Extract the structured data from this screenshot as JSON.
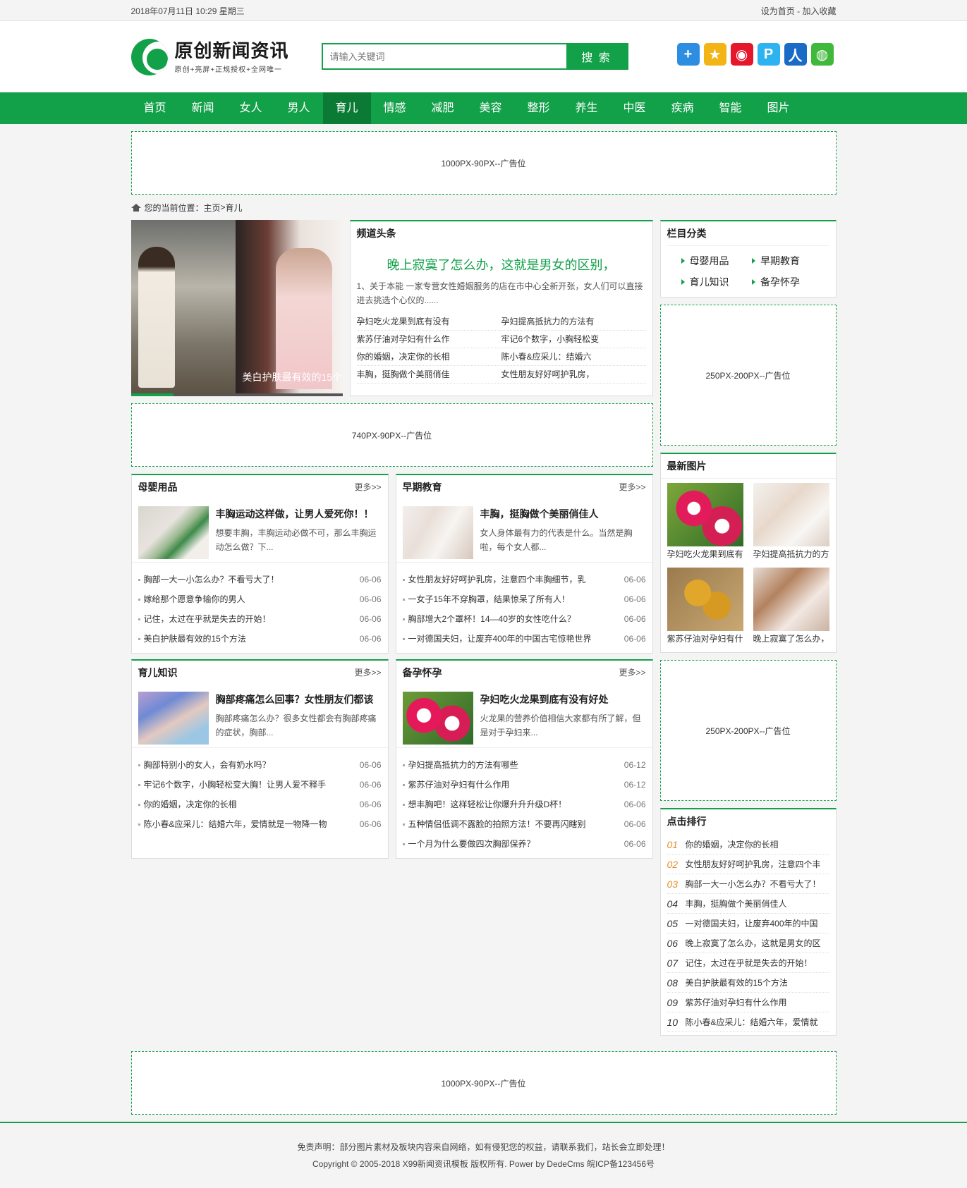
{
  "topbar": {
    "date": "2018年07月11日 10:29 星期三",
    "set_home": "设为首页",
    "sep": " - ",
    "favorite": "加入收藏"
  },
  "logo": {
    "title": "原创新闻资讯",
    "subtitle": "原创+亮屏+正规授权+全网唯一"
  },
  "search": {
    "placeholder": "请输入关键词",
    "button": "搜 索"
  },
  "share_icons": [
    {
      "name": "qzone-plus-icon",
      "color": "#2d8de0",
      "glyph": "+"
    },
    {
      "name": "qzone-star-icon",
      "color": "#f3b416",
      "glyph": "★"
    },
    {
      "name": "weibo-icon",
      "color": "#e6162d",
      "glyph": "◉"
    },
    {
      "name": "pengyou-icon",
      "color": "#2db3f0",
      "glyph": "P"
    },
    {
      "name": "renren-icon",
      "color": "#1a6bc6",
      "glyph": "人"
    },
    {
      "name": "wechat-icon",
      "color": "#3fb83b",
      "glyph": "◍"
    }
  ],
  "nav": [
    "首页",
    "新闻",
    "女人",
    "男人",
    "育儿",
    "情感",
    "减肥",
    "美容",
    "整形",
    "养生",
    "中医",
    "疾病",
    "智能",
    "图片"
  ],
  "nav_active": 4,
  "ads": {
    "top": "1000PX-90PX--广告位",
    "mid": "740PX-90PX--广告位",
    "right1": "250PX-200PX--广告位",
    "right2": "250PX-200PX--广告位",
    "bottom": "1000PX-90PX--广告位"
  },
  "breadcrumb": {
    "prefix": "您的当前位置：",
    "home": "主页",
    "sep": " > ",
    "current": "育儿"
  },
  "slider": {
    "caption": "美白护肤最有效的15个"
  },
  "headline": {
    "label": "频道头条",
    "title": "晚上寂寞了怎么办，这就是男女的区别，",
    "desc": "1、关于本能 一家专营女性婚姻服务的店在市中心全新开张，女人们可以直接进去挑选个心仪的......",
    "links": [
      "孕妇吃火龙果到底有没有",
      "孕妇提高抵抗力的方法有",
      "紫苏仔油对孕妇有什么作",
      "牢记6个数字，小胸轻松变",
      "你的婚姻，决定你的长相",
      "陈小春&应采儿：结婚六",
      "丰胸，挺胸做个美丽俏佳",
      "女性朋友好好呵护乳房，"
    ]
  },
  "categories": [
    {
      "title": "母婴用品",
      "more": "更多>>",
      "feat_title": "丰胸运动这样做，让男人爱死你！！",
      "feat_desc": "想要丰胸，丰胸运动必做不可，那么丰胸运动怎么做？下...",
      "items": [
        {
          "t": "胸部一大一小怎么办？不看亏大了！",
          "d": "06-06"
        },
        {
          "t": "嫁给那个愿意争输你的男人",
          "d": "06-06"
        },
        {
          "t": "记住，太过在乎就是失去的开始！",
          "d": "06-06"
        },
        {
          "t": "美白护肤最有效的15个方法",
          "d": "06-06"
        }
      ]
    },
    {
      "title": "早期教育",
      "more": "更多>>",
      "feat_title": "丰胸，挺胸做个美丽俏佳人",
      "feat_desc": "女人身体最有力的代表是什么。当然是胸啦，每个女人都...",
      "items": [
        {
          "t": "女性朋友好好呵护乳房，注意四个丰胸细节，乳",
          "d": "06-06"
        },
        {
          "t": "一女子15年不穿胸罩，结果惊呆了所有人！",
          "d": "06-06"
        },
        {
          "t": "胸部增大2个罩杯！14—40岁的女性吃什么？",
          "d": "06-06"
        },
        {
          "t": "一对德国夫妇，让废弃400年的中国古宅惊艳世界",
          "d": "06-06"
        }
      ]
    },
    {
      "title": "育儿知识",
      "more": "更多>>",
      "feat_title": "胸部疼痛怎么回事？女性朋友们都该",
      "feat_desc": "胸部疼痛怎么办？很多女性都会有胸部疼痛的症状，胸部...",
      "items": [
        {
          "t": "胸部特别小的女人，会有奶水吗？",
          "d": "06-06"
        },
        {
          "t": "牢记6个数字，小胸轻松变大胸！让男人爱不释手",
          "d": "06-06"
        },
        {
          "t": "你的婚姻，决定你的长相",
          "d": "06-06"
        },
        {
          "t": "陈小春&应采儿：结婚六年，爱情就是一物降一物",
          "d": "06-06"
        }
      ]
    },
    {
      "title": "备孕怀孕",
      "more": "更多>>",
      "feat_title": "孕妇吃火龙果到底有没有好处",
      "feat_desc": "火龙果的营养价值相信大家都有所了解，但是对于孕妇来...",
      "items": [
        {
          "t": "孕妇提高抵抗力的方法有哪些",
          "d": "06-12"
        },
        {
          "t": "紫苏仔油对孕妇有什么作用",
          "d": "06-12"
        },
        {
          "t": "想丰胸吧！这样轻松让你爆升升升级D杯！",
          "d": "06-06"
        },
        {
          "t": "五种情侣低调不露脸的拍照方法！不要再闪瞎别",
          "d": "06-06"
        },
        {
          "t": "一个月为什么要做四次胸部保养？",
          "d": "06-06"
        }
      ]
    }
  ],
  "sidebar": {
    "cat_title": "栏目分类",
    "cats": [
      "母婴用品",
      "早期教育",
      "育儿知识",
      "备孕怀孕"
    ],
    "pics_title": "最新图片",
    "pics": [
      "孕妇吃火龙果到底有",
      "孕妇提高抵抗力的方",
      "紫苏仔油对孕妇有什",
      "晚上寂寞了怎么办，"
    ],
    "rank_title": "点击排行",
    "rank": [
      {
        "n": "01",
        "t": "你的婚姻，决定你的长相"
      },
      {
        "n": "02",
        "t": "女性朋友好好呵护乳房，注意四个丰"
      },
      {
        "n": "03",
        "t": "胸部一大一小怎么办？不看亏大了！"
      },
      {
        "n": "04",
        "t": "丰胸，挺胸做个美丽俏佳人"
      },
      {
        "n": "05",
        "t": "一对德国夫妇，让废弃400年的中国"
      },
      {
        "n": "06",
        "t": "晚上寂寞了怎么办，这就是男女的区"
      },
      {
        "n": "07",
        "t": "记住，太过在乎就是失去的开始！"
      },
      {
        "n": "08",
        "t": "美白护肤最有效的15个方法"
      },
      {
        "n": "09",
        "t": "紫苏仔油对孕妇有什么作用"
      },
      {
        "n": "10",
        "t": "陈小春&应采儿：结婚六年，爱情就"
      }
    ]
  },
  "footer": {
    "line1": "免责声明：部分图片素材及板块内容来自网络，如有侵犯您的权益，请联系我们，站长会立即处理！",
    "line2": "Copyright © 2005-2018 X99新闻资讯模板 版权所有. Power by DedeCms 皖ICP备123456号"
  },
  "colors": {
    "brand": "#12a049",
    "brand_dark": "#0b7a35",
    "rank_hot": "#e58e2a"
  }
}
